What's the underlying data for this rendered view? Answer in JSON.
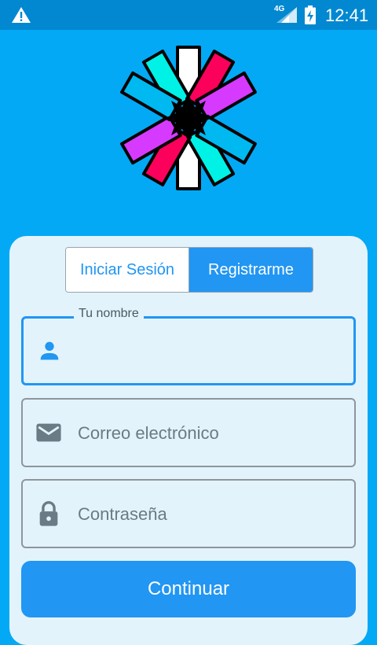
{
  "status_bar": {
    "network": "4G",
    "time": "12:41",
    "icons": [
      "warning-icon",
      "signal-icon",
      "battery-charging-icon"
    ]
  },
  "logo": {
    "icon": "jwt-logo"
  },
  "tabs": [
    {
      "label": "Iniciar Sesión",
      "selected": false
    },
    {
      "label": "Registrarme",
      "selected": true
    }
  ],
  "form": {
    "name": {
      "label": "Tu nombre",
      "value": "",
      "icon": "person-icon"
    },
    "email": {
      "placeholder": "Correo electrónico",
      "icon": "email-icon"
    },
    "password": {
      "placeholder": "Contraseña",
      "icon": "lock-icon"
    },
    "submit_label": "Continuar"
  },
  "colors": {
    "background": "#03A9F4",
    "status_bar": "#0288D1",
    "accent": "#2196F3",
    "card": "#E3F3FC"
  }
}
